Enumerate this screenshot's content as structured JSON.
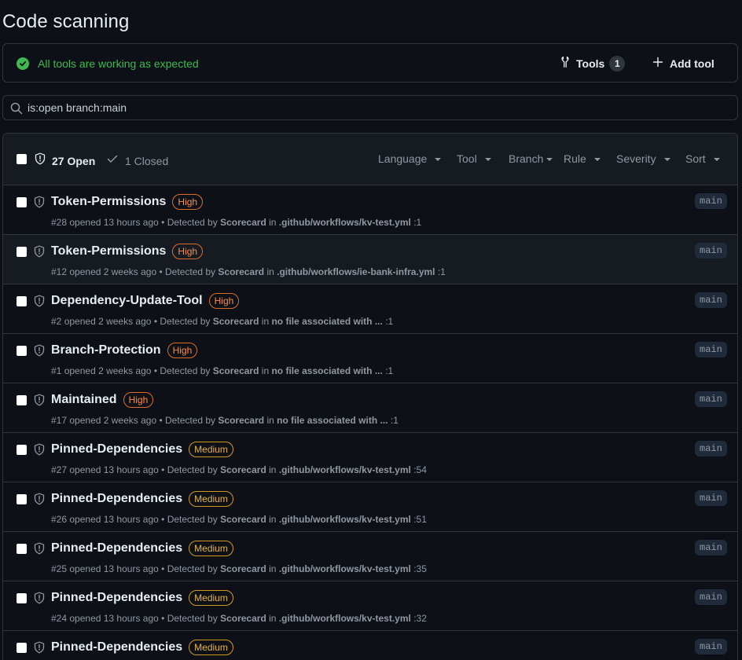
{
  "page": {
    "title": "Code scanning"
  },
  "tools_status": {
    "message": "All tools are working as expected",
    "tools_label": "Tools",
    "tools_count": "1",
    "add_tool_label": "Add tool"
  },
  "search": {
    "value": "is:open branch:main"
  },
  "alerts_header": {
    "open_label": "27 Open",
    "closed_label": "1 Closed",
    "filters": {
      "language": "Language",
      "tool": "Tool",
      "branch": "Branch",
      "rule": "Rule",
      "severity": "Severity",
      "sort": "Sort"
    }
  },
  "colors": {
    "background": "#0d1117",
    "success": "#3fb950",
    "severity_high": "#db6d28",
    "severity_medium": "#d29922"
  },
  "alerts": [
    {
      "title": "Token-Permissions",
      "severity": "High",
      "number": "#28",
      "opened": "opened 13 hours ago",
      "detected_prefix": "• Detected by",
      "tool": "Scorecard",
      "in": "in",
      "location": ".github/workflows/kv-test.yml",
      "line": ":1",
      "branch": "main"
    },
    {
      "title": "Token-Permissions",
      "severity": "High",
      "number": "#12",
      "opened": "opened 2 weeks ago",
      "detected_prefix": "• Detected by",
      "tool": "Scorecard",
      "in": "in",
      "location": ".github/workflows/ie-bank-infra.yml",
      "line": ":1",
      "branch": "main"
    },
    {
      "title": "Dependency-Update-Tool",
      "severity": "High",
      "number": "#2",
      "opened": "opened 2 weeks ago",
      "detected_prefix": "• Detected by",
      "tool": "Scorecard",
      "in": "in",
      "location": "no file associated with ...",
      "line": ":1",
      "branch": "main"
    },
    {
      "title": "Branch-Protection",
      "severity": "High",
      "number": "#1",
      "opened": "opened 2 weeks ago",
      "detected_prefix": "• Detected by",
      "tool": "Scorecard",
      "in": "in",
      "location": "no file associated with ...",
      "line": ":1",
      "branch": "main"
    },
    {
      "title": "Maintained",
      "severity": "High",
      "number": "#17",
      "opened": "opened 2 weeks ago",
      "detected_prefix": "• Detected by",
      "tool": "Scorecard",
      "in": "in",
      "location": "no file associated with ...",
      "line": ":1",
      "branch": "main"
    },
    {
      "title": "Pinned-Dependencies",
      "severity": "Medium",
      "number": "#27",
      "opened": "opened 13 hours ago",
      "detected_prefix": "• Detected by",
      "tool": "Scorecard",
      "in": "in",
      "location": ".github/workflows/kv-test.yml",
      "line": ":54",
      "branch": "main"
    },
    {
      "title": "Pinned-Dependencies",
      "severity": "Medium",
      "number": "#26",
      "opened": "opened 13 hours ago",
      "detected_prefix": "• Detected by",
      "tool": "Scorecard",
      "in": "in",
      "location": ".github/workflows/kv-test.yml",
      "line": ":51",
      "branch": "main"
    },
    {
      "title": "Pinned-Dependencies",
      "severity": "Medium",
      "number": "#25",
      "opened": "opened 13 hours ago",
      "detected_prefix": "• Detected by",
      "tool": "Scorecard",
      "in": "in",
      "location": ".github/workflows/kv-test.yml",
      "line": ":35",
      "branch": "main"
    },
    {
      "title": "Pinned-Dependencies",
      "severity": "Medium",
      "number": "#24",
      "opened": "opened 13 hours ago",
      "detected_prefix": "• Detected by",
      "tool": "Scorecard",
      "in": "in",
      "location": ".github/workflows/kv-test.yml",
      "line": ":32",
      "branch": "main"
    },
    {
      "title": "Pinned-Dependencies",
      "severity": "Medium",
      "number": "",
      "opened": "",
      "detected_prefix": "",
      "tool": "",
      "in": "",
      "location": "",
      "line": "",
      "branch": "main"
    }
  ]
}
